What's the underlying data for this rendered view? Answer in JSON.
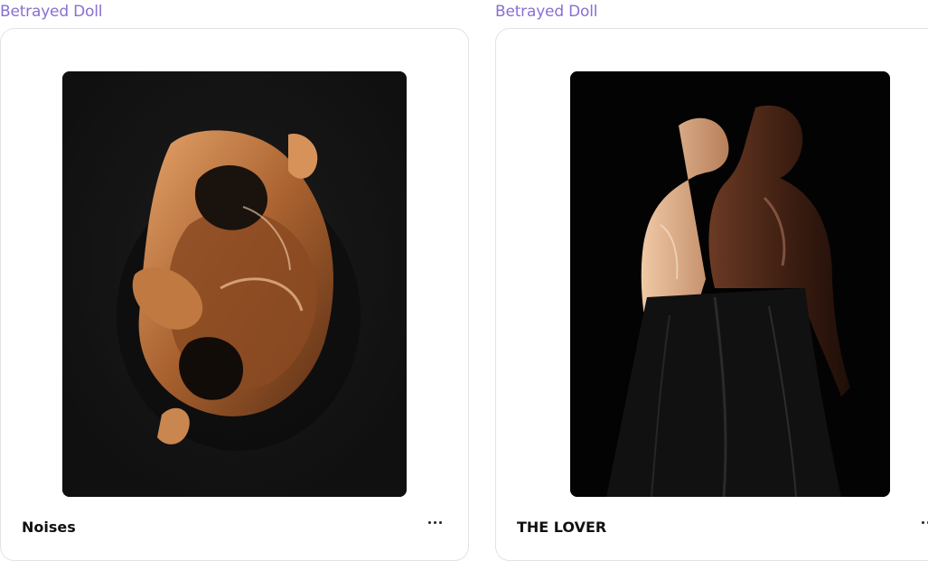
{
  "cards": [
    {
      "artist": "Betrayed Doll",
      "title": "Noises",
      "more_icon": "ellipsis-horizontal-icon"
    },
    {
      "artist": "Betrayed Doll",
      "title": "THE LOVER",
      "more_icon": "ellipsis-horizontal-icon"
    }
  ]
}
